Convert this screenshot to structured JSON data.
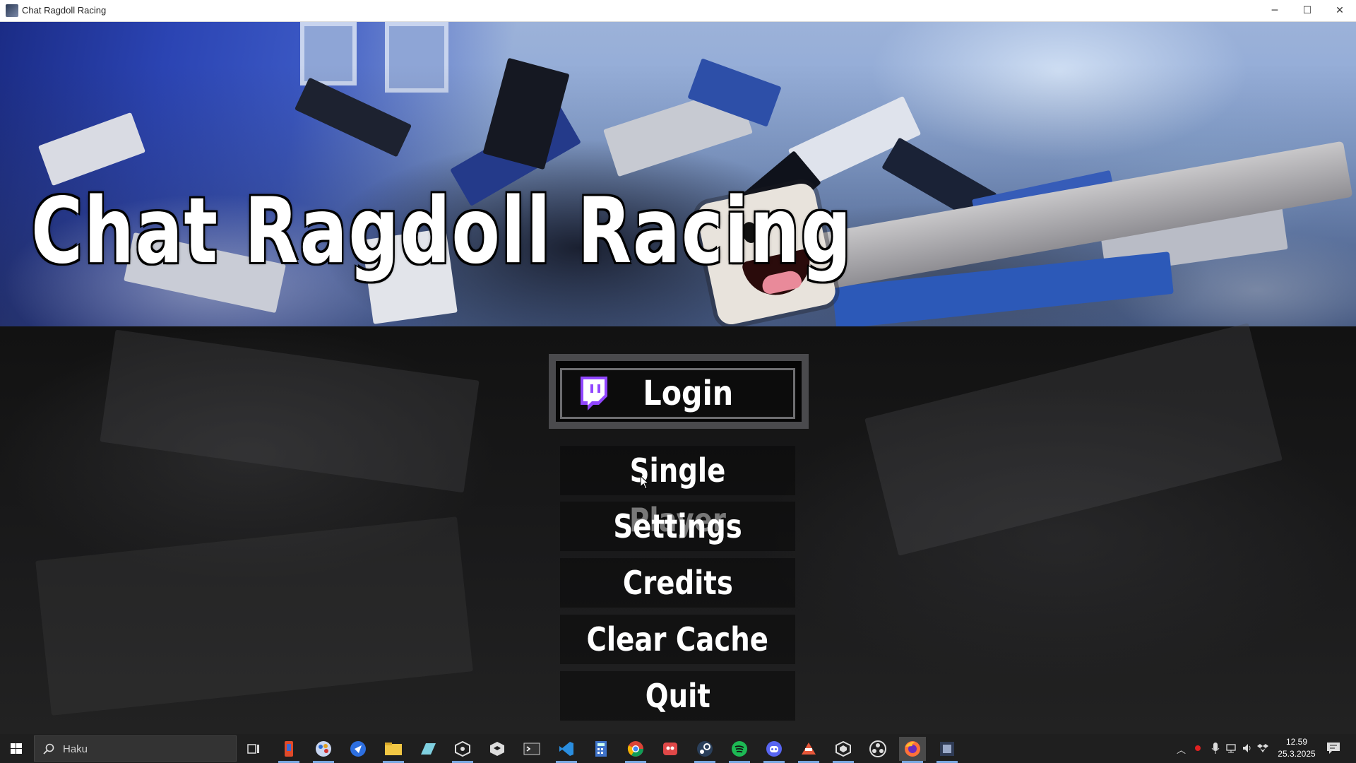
{
  "window": {
    "title": "Chat Ragdoll Racing",
    "minimize_glyph": "─",
    "maximize_glyph": "☐",
    "close_glyph": "✕"
  },
  "game": {
    "title": "Chat Ragdoll Racing",
    "accent_color": "#9146ff",
    "menu": {
      "login": "Login",
      "single_player": "Single Player",
      "settings": "Settings",
      "credits": "Credits",
      "clear_cache": "Clear Cache",
      "quit": "Quit"
    }
  },
  "taskbar": {
    "search_placeholder": "Haku",
    "pinned": [
      "task-view-icon",
      "tool-app-icon",
      "paint-app-icon",
      "blue-app-icon",
      "file-explorer-icon",
      "drive-app-icon",
      "unity-hub-icon",
      "unity-icon",
      "terminal-icon",
      "vscode-icon",
      "calculator-icon",
      "chrome-icon",
      "red-app-icon",
      "steam-icon",
      "spotify-icon",
      "discord-icon",
      "orange-app-icon",
      "unity-editor-icon",
      "obs-icon",
      "firefox-icon",
      "game-app-icon"
    ],
    "clock": {
      "time": "12.59",
      "date": "25.3.2025"
    }
  }
}
